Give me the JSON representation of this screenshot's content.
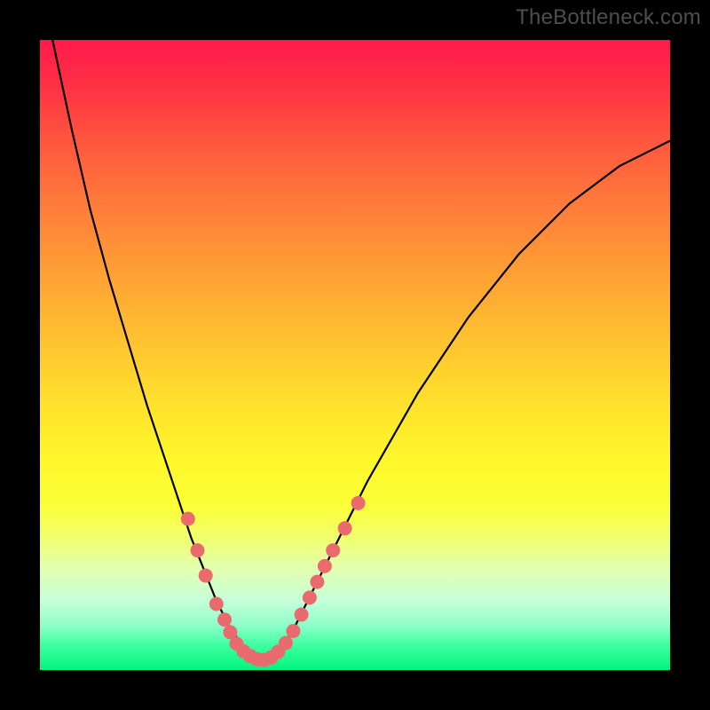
{
  "watermark": "TheBottleneck.com",
  "colors": {
    "frame": "#000000",
    "curve": "#000000",
    "dot_fill": "#ea6b6e",
    "gradient_top": "#ff1a4b",
    "gradient_bottom": "#00f57c"
  },
  "chart_data": {
    "type": "line",
    "title": "",
    "xlabel": "",
    "ylabel": "",
    "xlim": [
      0,
      100
    ],
    "ylim": [
      0,
      100
    ],
    "x": [
      0,
      2,
      5,
      8,
      11,
      14,
      17,
      20,
      22,
      24,
      26,
      28,
      30,
      32,
      34,
      36,
      38,
      40,
      44,
      48,
      52,
      56,
      60,
      64,
      68,
      72,
      76,
      80,
      84,
      88,
      92,
      96,
      100
    ],
    "series": [
      {
        "name": "bottleneck-curve",
        "values": [
          110,
          100,
          86,
          73,
          62,
          52,
          42,
          33,
          27,
          21,
          16,
          11,
          7,
          4,
          2,
          1,
          3,
          6,
          14,
          22,
          30,
          37,
          44,
          50,
          56,
          61,
          66,
          70,
          74,
          77,
          80,
          82,
          84
        ]
      }
    ],
    "highlights": {
      "name": "dots",
      "points": [
        {
          "x": 23.5,
          "y": 24
        },
        {
          "x": 25.0,
          "y": 19
        },
        {
          "x": 26.3,
          "y": 15
        },
        {
          "x": 28.0,
          "y": 10.5
        },
        {
          "x": 29.3,
          "y": 8
        },
        {
          "x": 30.2,
          "y": 6
        },
        {
          "x": 31.2,
          "y": 4.2
        },
        {
          "x": 32.3,
          "y": 3.0
        },
        {
          "x": 33.4,
          "y": 2.2
        },
        {
          "x": 34.5,
          "y": 1.7
        },
        {
          "x": 35.6,
          "y": 1.6
        },
        {
          "x": 36.7,
          "y": 2.0
        },
        {
          "x": 37.8,
          "y": 2.9
        },
        {
          "x": 39.0,
          "y": 4.3
        },
        {
          "x": 40.2,
          "y": 6.2
        },
        {
          "x": 41.5,
          "y": 8.8
        },
        {
          "x": 42.8,
          "y": 11.5
        },
        {
          "x": 44.0,
          "y": 14.0
        },
        {
          "x": 45.2,
          "y": 16.5
        },
        {
          "x": 46.5,
          "y": 19.0
        },
        {
          "x": 48.4,
          "y": 22.5
        },
        {
          "x": 50.5,
          "y": 26.5
        }
      ]
    }
  }
}
